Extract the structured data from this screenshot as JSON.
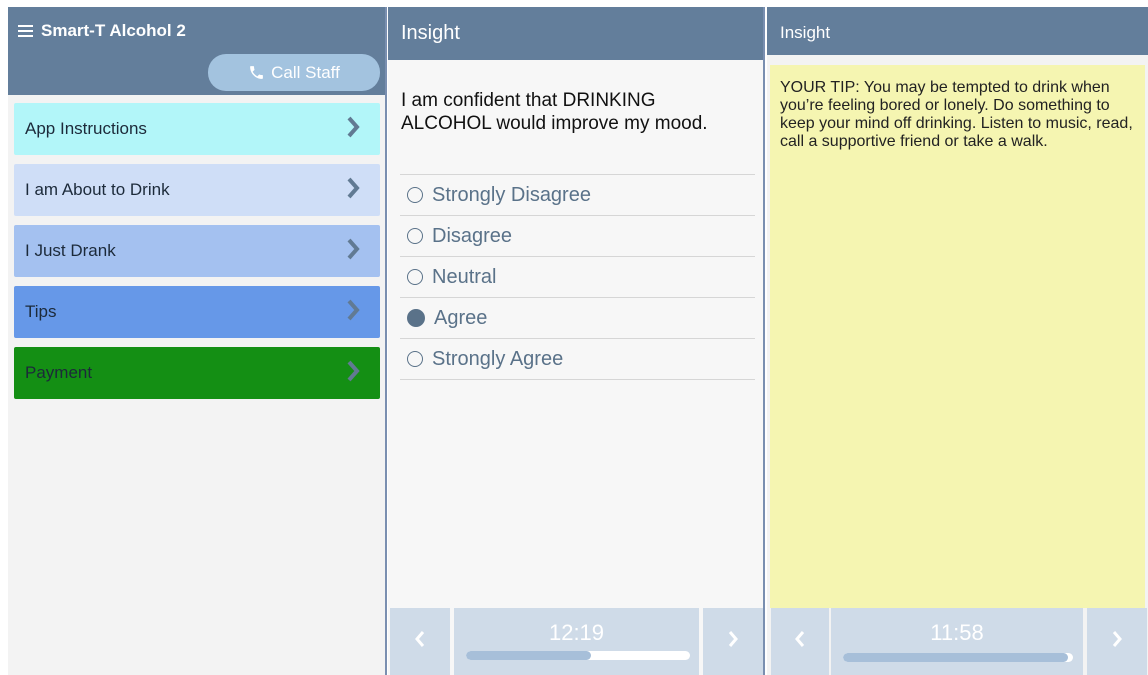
{
  "left_panel": {
    "app_title": "Smart-T Alcohol 2",
    "call_button": "Call Staff",
    "menu": [
      {
        "label": "App Instructions"
      },
      {
        "label": "I am About to Drink"
      },
      {
        "label": "I Just Drank"
      },
      {
        "label": "Tips"
      },
      {
        "label": "Payment"
      }
    ]
  },
  "middle_panel": {
    "title": "Insight",
    "question": "I am confident that DRINKING ALCOHOL would improve my mood.",
    "options": [
      {
        "label": "Strongly Disagree",
        "selected": false
      },
      {
        "label": "Disagree",
        "selected": false
      },
      {
        "label": "Neutral",
        "selected": false
      },
      {
        "label": "Agree",
        "selected": true
      },
      {
        "label": "Strongly Agree",
        "selected": false
      }
    ],
    "timer": "12:19",
    "progress": 0.56
  },
  "right_panel": {
    "title": "Insight",
    "tip": "YOUR TIP: You may be tempted to drink when you’re feeling bored or lonely. Do something to keep your mind off drinking. Listen to music, read, call a supportive friend or take a walk.",
    "timer": "11:58",
    "progress": 0.98
  },
  "icons": {
    "menu": "hamburger-icon",
    "call": "phone-icon",
    "menu_arrow": "chevron-right-icon",
    "prev": "chevron-left-icon",
    "next": "chevron-right-icon"
  },
  "colors": {
    "header": "#637e9b",
    "call_button": "#a3c3df",
    "menu_item_colors": [
      "#b2f6f9",
      "#cfdef7",
      "#a4c1f0",
      "#6698e8",
      "#148f14"
    ],
    "tip_background": "#f5f5b1",
    "option_text": "#5a7289"
  }
}
